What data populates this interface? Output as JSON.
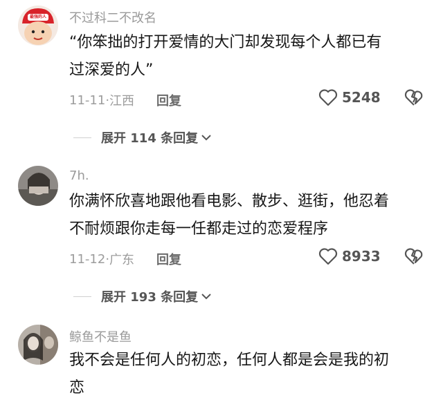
{
  "comments": [
    {
      "username": "不过科二不改名",
      "avatar_badge": "最强的人",
      "text_lines": [
        "“你笨拙的打开爱情的大门却发现每个人都已有",
        "过深爱的人”"
      ],
      "date": "11-11",
      "location": "江西",
      "reply_label": "回复",
      "likes": "5248",
      "expand_label": "展开 114 条回复",
      "avatar_icon": "cartoon-avatar-icon"
    },
    {
      "username": "7h.",
      "text_lines": [
        "你满怀欣喜地跟他看电影、散步、逛街，他忍着",
        "不耐烦跟你走每一任都走过的恋爱程序"
      ],
      "date": "11-12",
      "location": "广东",
      "reply_label": "回复",
      "likes": "8933",
      "expand_label": "展开 193 条回复",
      "avatar_icon": "photo-avatar-icon"
    },
    {
      "username": "鲸鱼不是鱼",
      "text_lines": [
        "我不会是任何人的初恋，任何人都是会是我的初",
        "恋"
      ],
      "avatar_icon": "photo-avatar-icon"
    }
  ],
  "icons": {
    "like": "heart-outline-icon",
    "dislike": "broken-heart-icon",
    "expand": "chevron-down-icon"
  },
  "colors": {
    "text": "#161616",
    "muted": "#9c9c9c"
  }
}
